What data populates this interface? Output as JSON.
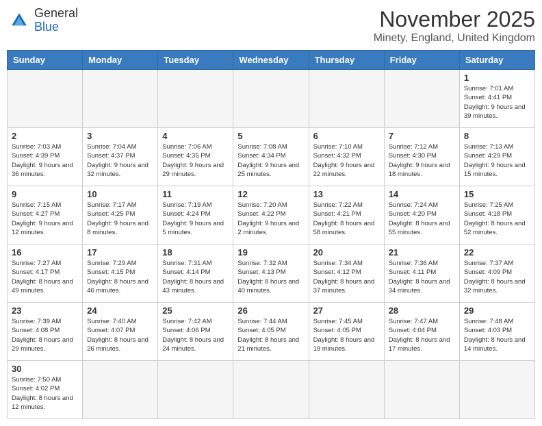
{
  "header": {
    "logo_line1": "General",
    "logo_line2": "Blue",
    "month": "November 2025",
    "location": "Minety, England, United Kingdom"
  },
  "days_of_week": [
    "Sunday",
    "Monday",
    "Tuesday",
    "Wednesday",
    "Thursday",
    "Friday",
    "Saturday"
  ],
  "weeks": [
    [
      {
        "day": "",
        "info": ""
      },
      {
        "day": "",
        "info": ""
      },
      {
        "day": "",
        "info": ""
      },
      {
        "day": "",
        "info": ""
      },
      {
        "day": "",
        "info": ""
      },
      {
        "day": "",
        "info": ""
      },
      {
        "day": "1",
        "info": "Sunrise: 7:01 AM\nSunset: 4:41 PM\nDaylight: 9 hours and 39 minutes."
      }
    ],
    [
      {
        "day": "2",
        "info": "Sunrise: 7:03 AM\nSunset: 4:39 PM\nDaylight: 9 hours and 36 minutes."
      },
      {
        "day": "3",
        "info": "Sunrise: 7:04 AM\nSunset: 4:37 PM\nDaylight: 9 hours and 32 minutes."
      },
      {
        "day": "4",
        "info": "Sunrise: 7:06 AM\nSunset: 4:35 PM\nDaylight: 9 hours and 29 minutes."
      },
      {
        "day": "5",
        "info": "Sunrise: 7:08 AM\nSunset: 4:34 PM\nDaylight: 9 hours and 25 minutes."
      },
      {
        "day": "6",
        "info": "Sunrise: 7:10 AM\nSunset: 4:32 PM\nDaylight: 9 hours and 22 minutes."
      },
      {
        "day": "7",
        "info": "Sunrise: 7:12 AM\nSunset: 4:30 PM\nDaylight: 9 hours and 18 minutes."
      },
      {
        "day": "8",
        "info": "Sunrise: 7:13 AM\nSunset: 4:29 PM\nDaylight: 9 hours and 15 minutes."
      }
    ],
    [
      {
        "day": "9",
        "info": "Sunrise: 7:15 AM\nSunset: 4:27 PM\nDaylight: 9 hours and 12 minutes."
      },
      {
        "day": "10",
        "info": "Sunrise: 7:17 AM\nSunset: 4:25 PM\nDaylight: 9 hours and 8 minutes."
      },
      {
        "day": "11",
        "info": "Sunrise: 7:19 AM\nSunset: 4:24 PM\nDaylight: 9 hours and 5 minutes."
      },
      {
        "day": "12",
        "info": "Sunrise: 7:20 AM\nSunset: 4:22 PM\nDaylight: 9 hours and 2 minutes."
      },
      {
        "day": "13",
        "info": "Sunrise: 7:22 AM\nSunset: 4:21 PM\nDaylight: 8 hours and 58 minutes."
      },
      {
        "day": "14",
        "info": "Sunrise: 7:24 AM\nSunset: 4:20 PM\nDaylight: 8 hours and 55 minutes."
      },
      {
        "day": "15",
        "info": "Sunrise: 7:25 AM\nSunset: 4:18 PM\nDaylight: 8 hours and 52 minutes."
      }
    ],
    [
      {
        "day": "16",
        "info": "Sunrise: 7:27 AM\nSunset: 4:17 PM\nDaylight: 8 hours and 49 minutes."
      },
      {
        "day": "17",
        "info": "Sunrise: 7:29 AM\nSunset: 4:15 PM\nDaylight: 8 hours and 46 minutes."
      },
      {
        "day": "18",
        "info": "Sunrise: 7:31 AM\nSunset: 4:14 PM\nDaylight: 8 hours and 43 minutes."
      },
      {
        "day": "19",
        "info": "Sunrise: 7:32 AM\nSunset: 4:13 PM\nDaylight: 8 hours and 40 minutes."
      },
      {
        "day": "20",
        "info": "Sunrise: 7:34 AM\nSunset: 4:12 PM\nDaylight: 8 hours and 37 minutes."
      },
      {
        "day": "21",
        "info": "Sunrise: 7:36 AM\nSunset: 4:11 PM\nDaylight: 8 hours and 34 minutes."
      },
      {
        "day": "22",
        "info": "Sunrise: 7:37 AM\nSunset: 4:09 PM\nDaylight: 8 hours and 32 minutes."
      }
    ],
    [
      {
        "day": "23",
        "info": "Sunrise: 7:39 AM\nSunset: 4:08 PM\nDaylight: 8 hours and 29 minutes."
      },
      {
        "day": "24",
        "info": "Sunrise: 7:40 AM\nSunset: 4:07 PM\nDaylight: 8 hours and 26 minutes."
      },
      {
        "day": "25",
        "info": "Sunrise: 7:42 AM\nSunset: 4:06 PM\nDaylight: 8 hours and 24 minutes."
      },
      {
        "day": "26",
        "info": "Sunrise: 7:44 AM\nSunset: 4:05 PM\nDaylight: 8 hours and 21 minutes."
      },
      {
        "day": "27",
        "info": "Sunrise: 7:45 AM\nSunset: 4:05 PM\nDaylight: 8 hours and 19 minutes."
      },
      {
        "day": "28",
        "info": "Sunrise: 7:47 AM\nSunset: 4:04 PM\nDaylight: 8 hours and 17 minutes."
      },
      {
        "day": "29",
        "info": "Sunrise: 7:48 AM\nSunset: 4:03 PM\nDaylight: 8 hours and 14 minutes."
      }
    ],
    [
      {
        "day": "30",
        "info": "Sunrise: 7:50 AM\nSunset: 4:02 PM\nDaylight: 8 hours and 12 minutes."
      },
      {
        "day": "",
        "info": ""
      },
      {
        "day": "",
        "info": ""
      },
      {
        "day": "",
        "info": ""
      },
      {
        "day": "",
        "info": ""
      },
      {
        "day": "",
        "info": ""
      },
      {
        "day": "",
        "info": ""
      }
    ]
  ]
}
